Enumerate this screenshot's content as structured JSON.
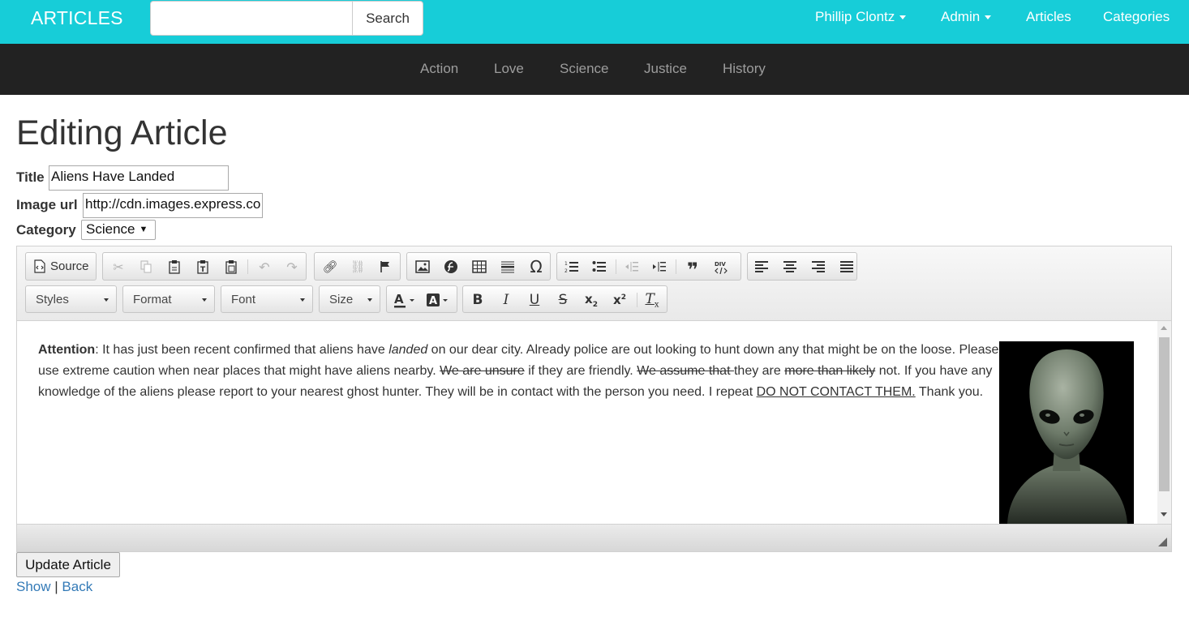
{
  "navbar": {
    "brand": "ARTICLES",
    "search": {
      "value": "",
      "placeholder": "",
      "button": "Search"
    },
    "user_menu": "Phillip Clontz",
    "admin_menu": "Admin",
    "articles_link": "Articles",
    "categories_link": "Categories",
    "colors": {
      "navbar_bg": "#17cdd8",
      "catbar_bg": "#222222"
    }
  },
  "categories": [
    "Action",
    "Love",
    "Science",
    "Justice",
    "History"
  ],
  "page": {
    "title": "Editing Article",
    "title_label": "Title",
    "title_value": "Aliens Have Landed",
    "image_label": "Image url",
    "image_value": "http://cdn.images.express.co",
    "category_label": "Category",
    "category_value": "Science"
  },
  "editor": {
    "source_label": "Source",
    "styles_label": "Styles",
    "format_label": "Format",
    "font_label": "Font",
    "size_label": "Size",
    "content": {
      "p1_bold": "Attention",
      "p1_a": ": It has just been recent confirmed that aliens have ",
      "p1_italic": "landed",
      "p1_b": " on our dear city. Already police are out looking to hunt down any that might be on the loose. Please use extreme caution when near places that might have aliens nearby. ",
      "strike1": "We are unsure",
      "p1_c": " if they are friendly. ",
      "strike2": "We assume that ",
      "p1_d": "they are ",
      "strike3": "more than likely",
      "p1_e": " not. If you have any knowledge of the aliens please report to your nearest ghost hunter. They will be in contact with the person you need. I repeat ",
      "underline": "DO NOT CONTACT THEM.",
      "p1_f": " Thank you."
    },
    "image_alt": "alien portrait"
  },
  "actions": {
    "submit": "Update Article",
    "show": "Show",
    "separator": "|",
    "back": "Back"
  }
}
